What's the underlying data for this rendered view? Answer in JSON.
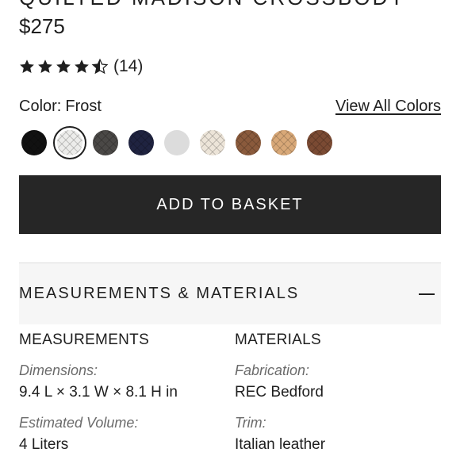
{
  "product": {
    "title": "QUILTED MADISON CROSSBODY",
    "price": "$275",
    "rating": 4.5,
    "review_count": "(14)"
  },
  "color": {
    "label": "Color:",
    "selected_name": "Frost",
    "view_all_label": "View All Colors",
    "swatches": [
      {
        "hex": "#111111"
      },
      {
        "hex": "#ececea"
      },
      {
        "hex": "#4a4846"
      },
      {
        "hex": "#1f2340"
      },
      {
        "hex": "#dcdcdc"
      },
      {
        "hex": "#ece4d8"
      },
      {
        "hex": "#8a5a3c"
      },
      {
        "hex": "#d8a878"
      },
      {
        "hex": "#7a4a33"
      }
    ]
  },
  "actions": {
    "add_to_basket_label": "ADD TO BASKET"
  },
  "accordion": {
    "title": "MEASUREMENTS & MATERIALS",
    "expanded": true
  },
  "measurements": {
    "heading": "MEASUREMENTS",
    "dimensions_label": "Dimensions:",
    "dimensions_value": "9.4 L × 3.1 W × 8.1 H in",
    "volume_label": "Estimated Volume:",
    "volume_value": "4 Liters"
  },
  "materials": {
    "heading": "MATERIALS",
    "fabrication_label": "Fabrication:",
    "fabrication_value": "REC Bedford",
    "trim_label": "Trim:",
    "trim_value": "Italian leather"
  }
}
